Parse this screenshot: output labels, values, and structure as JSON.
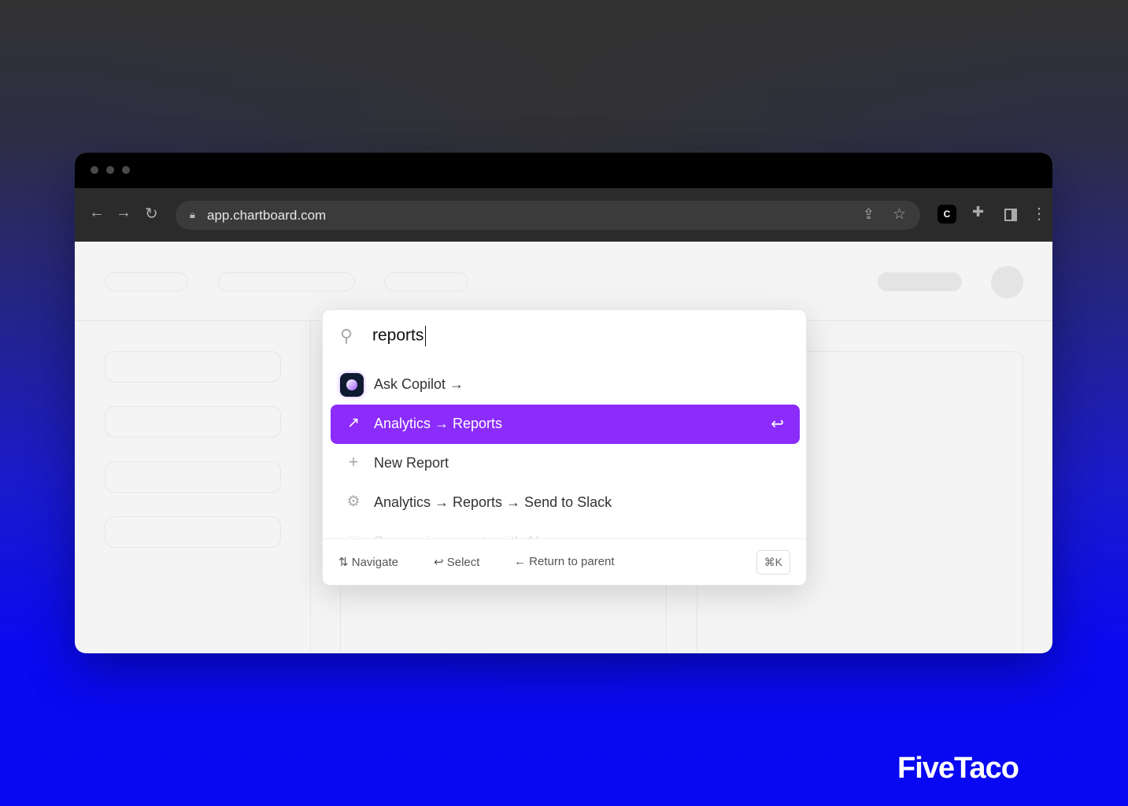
{
  "browser": {
    "url": "app.chartboard.com",
    "icons": [
      "back-icon",
      "forward-icon",
      "reload-icon",
      "lock-icon",
      "share-icon",
      "star-icon",
      "extension-icon",
      "puzzle-icon",
      "sidebar-icon",
      "more-icon"
    ]
  },
  "palette": {
    "query": "reports",
    "items": [
      {
        "label": "Ask Copilot →",
        "icon": "copilot-icon"
      },
      {
        "label": "Analytics → Reports",
        "icon": "arrow-up-right-icon",
        "selected": true
      },
      {
        "label": "New Report",
        "icon": "plus-icon"
      },
      {
        "label": "Analytics → Reports → Send to Slack",
        "icon": "gear-icon"
      },
      {
        "label": "Summarize reports with AI",
        "icon": "document-icon"
      }
    ],
    "footer": {
      "navigate": "Navigate",
      "select": "Select",
      "return": "Return to parent",
      "shortcut": "⌘K"
    },
    "accent": "#8b2cfb"
  },
  "brand": "FiveTaco"
}
